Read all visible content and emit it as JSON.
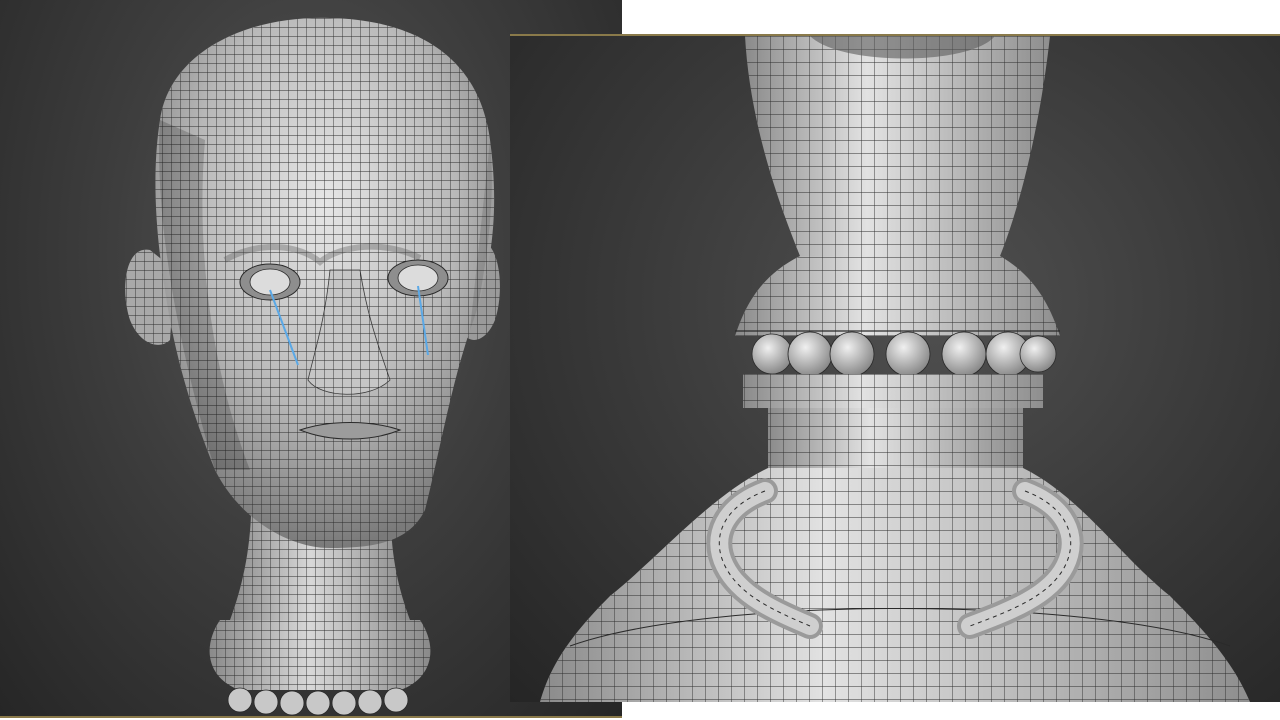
{
  "canvas": {
    "background": "#ffffff"
  },
  "viewports": [
    {
      "id": "left",
      "subject": "head-bust-wireframe-mesh",
      "background_color": "#3a3a3a",
      "mesh_color": "#bdbdbd",
      "wire_color": "#2a2a2a",
      "accent_color": "#5aa8e6"
    },
    {
      "id": "right",
      "subject": "vase-neck-wireframe-mesh",
      "background_color": "#363636",
      "mesh_color": "#c4c4c4",
      "wire_color": "#2a2a2a",
      "frame_color": "#8a7a4a"
    }
  ]
}
